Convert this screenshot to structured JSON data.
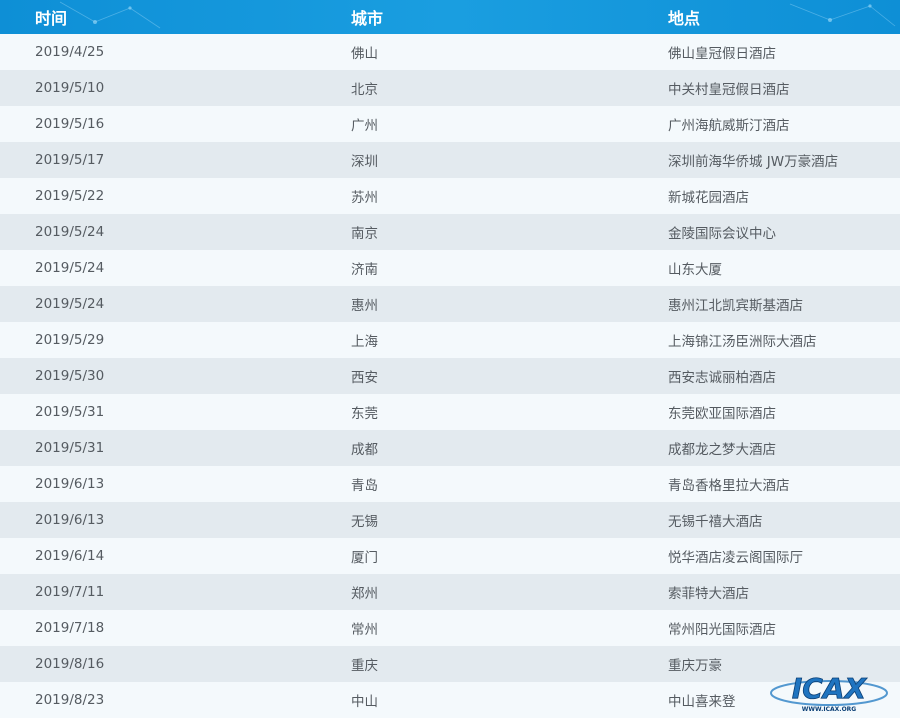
{
  "table": {
    "headers": {
      "time": "时间",
      "city": "城市",
      "location": "地点"
    },
    "rows": [
      {
        "time": "2019/4/25",
        "city": "佛山",
        "location": "佛山皇冠假日酒店"
      },
      {
        "time": "2019/5/10",
        "city": "北京",
        "location": "中关村皇冠假日酒店"
      },
      {
        "time": "2019/5/16",
        "city": "广州",
        "location": "广州海航威斯汀酒店"
      },
      {
        "time": "2019/5/17",
        "city": "深圳",
        "location": "深圳前海华侨城 JW万豪酒店"
      },
      {
        "time": "2019/5/22",
        "city": "苏州",
        "location": "新城花园酒店"
      },
      {
        "time": "2019/5/24",
        "city": "南京",
        "location": "金陵国际会议中心"
      },
      {
        "time": "2019/5/24",
        "city": "济南",
        "location": "山东大厦"
      },
      {
        "time": "2019/5/24",
        "city": "惠州",
        "location": "惠州江北凯宾斯基酒店"
      },
      {
        "time": "2019/5/29",
        "city": "上海",
        "location": "上海锦江汤臣洲际大酒店"
      },
      {
        "time": "2019/5/30",
        "city": "西安",
        "location": "西安志诚丽柏酒店"
      },
      {
        "time": "2019/5/31",
        "city": "东莞",
        "location": "东莞欧亚国际酒店"
      },
      {
        "time": "2019/5/31",
        "city": "成都",
        "location": "成都龙之梦大酒店"
      },
      {
        "time": "2019/6/13",
        "city": "青岛",
        "location": "青岛香格里拉大酒店"
      },
      {
        "time": "2019/6/13",
        "city": "无锡",
        "location": "无锡千禧大酒店"
      },
      {
        "time": "2019/6/14",
        "city": "厦门",
        "location": "悦华酒店凌云阁国际厅"
      },
      {
        "time": "2019/7/11",
        "city": "郑州",
        "location": "索菲特大酒店"
      },
      {
        "time": "2019/7/18",
        "city": "常州",
        "location": "常州阳光国际酒店"
      },
      {
        "time": "2019/8/16",
        "city": "重庆",
        "location": "重庆万豪"
      },
      {
        "time": "2019/8/23",
        "city": "中山",
        "location": "中山喜来登"
      }
    ]
  },
  "watermark": {
    "text": "ICAX",
    "subtext": "WWW.ICAX.ORG"
  },
  "colors": {
    "header_bg": "#1196d9",
    "row_odd": "#f4f9fc",
    "row_even": "#e3eaef",
    "text": "#555b61"
  }
}
